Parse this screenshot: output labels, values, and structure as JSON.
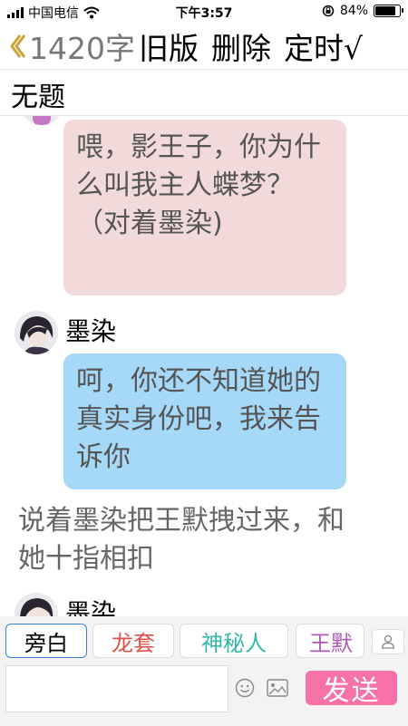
{
  "status_bar": {
    "carrier": "中国电信",
    "time": "下午3:57",
    "battery_percent": "84%",
    "battery_level": 0.84
  },
  "toolbar": {
    "word_count": "1420字",
    "buttons": [
      "旧版",
      "删除",
      "定时√"
    ]
  },
  "document": {
    "title": "无题"
  },
  "messages": [
    {
      "type": "bubble",
      "color": "#f3dada",
      "text": "喂，影王子，你为什么叫我主人蝶梦？（对着墨染)"
    },
    {
      "type": "bubble",
      "speaker": "墨染",
      "color": "#a6d8f7",
      "text": "呵，你还不知道她的真实身份吧，我来告诉你"
    },
    {
      "type": "narration",
      "text": "说着墨染把王默拽过来，和她十指相扣"
    },
    {
      "type": "speaker_only",
      "speaker": "墨染"
    }
  ],
  "roles": [
    {
      "label": "旁白",
      "color": "#000000",
      "active": true
    },
    {
      "label": "龙套",
      "color": "#e0504a",
      "active": false
    },
    {
      "label": "神秘人",
      "color": "#35b8a8",
      "active": false
    },
    {
      "label": "王默",
      "color": "#b05ab8",
      "active": false
    }
  ],
  "input": {
    "value": "",
    "send_label": "发送",
    "send_color": "#f872a8"
  }
}
